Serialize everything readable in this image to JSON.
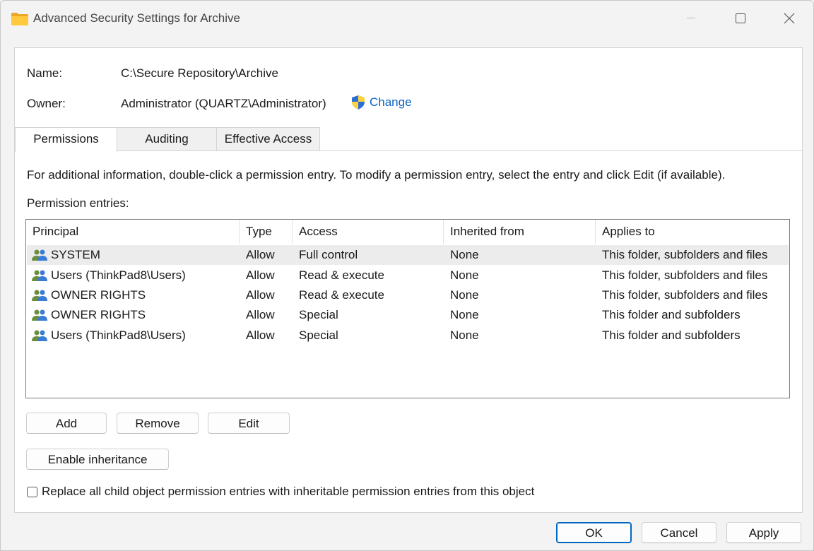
{
  "window": {
    "title": "Advanced Security Settings for Archive",
    "minimize_label": "Minimize",
    "maximize_label": "Maximize",
    "close_label": "Close"
  },
  "object": {
    "name_label": "Name:",
    "name_value": "C:\\Secure Repository\\Archive",
    "owner_label": "Owner:",
    "owner_value": "Administrator (QUARTZ\\Administrator)",
    "change_label": "Change"
  },
  "tabs": [
    {
      "label": "Permissions",
      "active": true
    },
    {
      "label": "Auditing",
      "active": false
    },
    {
      "label": "Effective Access",
      "active": false
    }
  ],
  "info_text": "For additional information, double-click a permission entry. To modify a permission entry, select the entry and click Edit (if available).",
  "entries_label": "Permission entries:",
  "table": {
    "columns": [
      "Principal",
      "Type",
      "Access",
      "Inherited from",
      "Applies to"
    ],
    "rows": [
      {
        "principal": "SYSTEM",
        "type": "Allow",
        "access": "Full control",
        "inherited": "None",
        "applies": "This folder, subfolders and files",
        "selected": true
      },
      {
        "principal": "Users (ThinkPad8\\Users)",
        "type": "Allow",
        "access": "Read & execute",
        "inherited": "None",
        "applies": "This folder, subfolders and files",
        "selected": false
      },
      {
        "principal": "OWNER RIGHTS",
        "type": "Allow",
        "access": "Read & execute",
        "inherited": "None",
        "applies": "This folder, subfolders and files",
        "selected": false
      },
      {
        "principal": "OWNER RIGHTS",
        "type": "Allow",
        "access": "Special",
        "inherited": "None",
        "applies": "This folder and subfolders",
        "selected": false
      },
      {
        "principal": "Users (ThinkPad8\\Users)",
        "type": "Allow",
        "access": "Special",
        "inherited": "None",
        "applies": "This folder and subfolders",
        "selected": false
      }
    ]
  },
  "buttons": {
    "add": "Add",
    "remove": "Remove",
    "edit": "Edit",
    "enable_inheritance": "Enable inheritance",
    "ok": "OK",
    "cancel": "Cancel",
    "apply": "Apply"
  },
  "replace_checkbox": {
    "label": "Replace all child object permission entries with inheritable permission entries from this object",
    "checked": false
  },
  "colors": {
    "link": "#0b63c4",
    "primary_border": "#0067c0",
    "selected_row": "#ececec"
  },
  "icons": {
    "title": "folder-icon",
    "change": "uac-shield-icon",
    "principal": "users-group-icon"
  }
}
